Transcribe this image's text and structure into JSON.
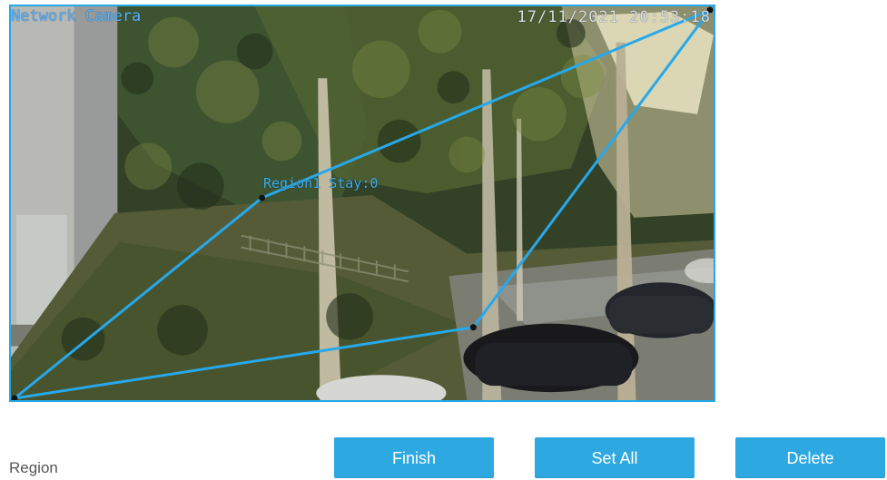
{
  "video": {
    "camera_name": "Network Camera",
    "timestamp": "17/11/2021  20:53:18",
    "region_overlay_label": "Region1 Stay:0"
  },
  "controls": {
    "region_label": "Region",
    "finish_label": "Finish",
    "set_all_label": "Set All",
    "delete_label": "Delete"
  },
  "colors": {
    "accent": "#2ea8e0",
    "overlay_line": "#25a9e8"
  }
}
